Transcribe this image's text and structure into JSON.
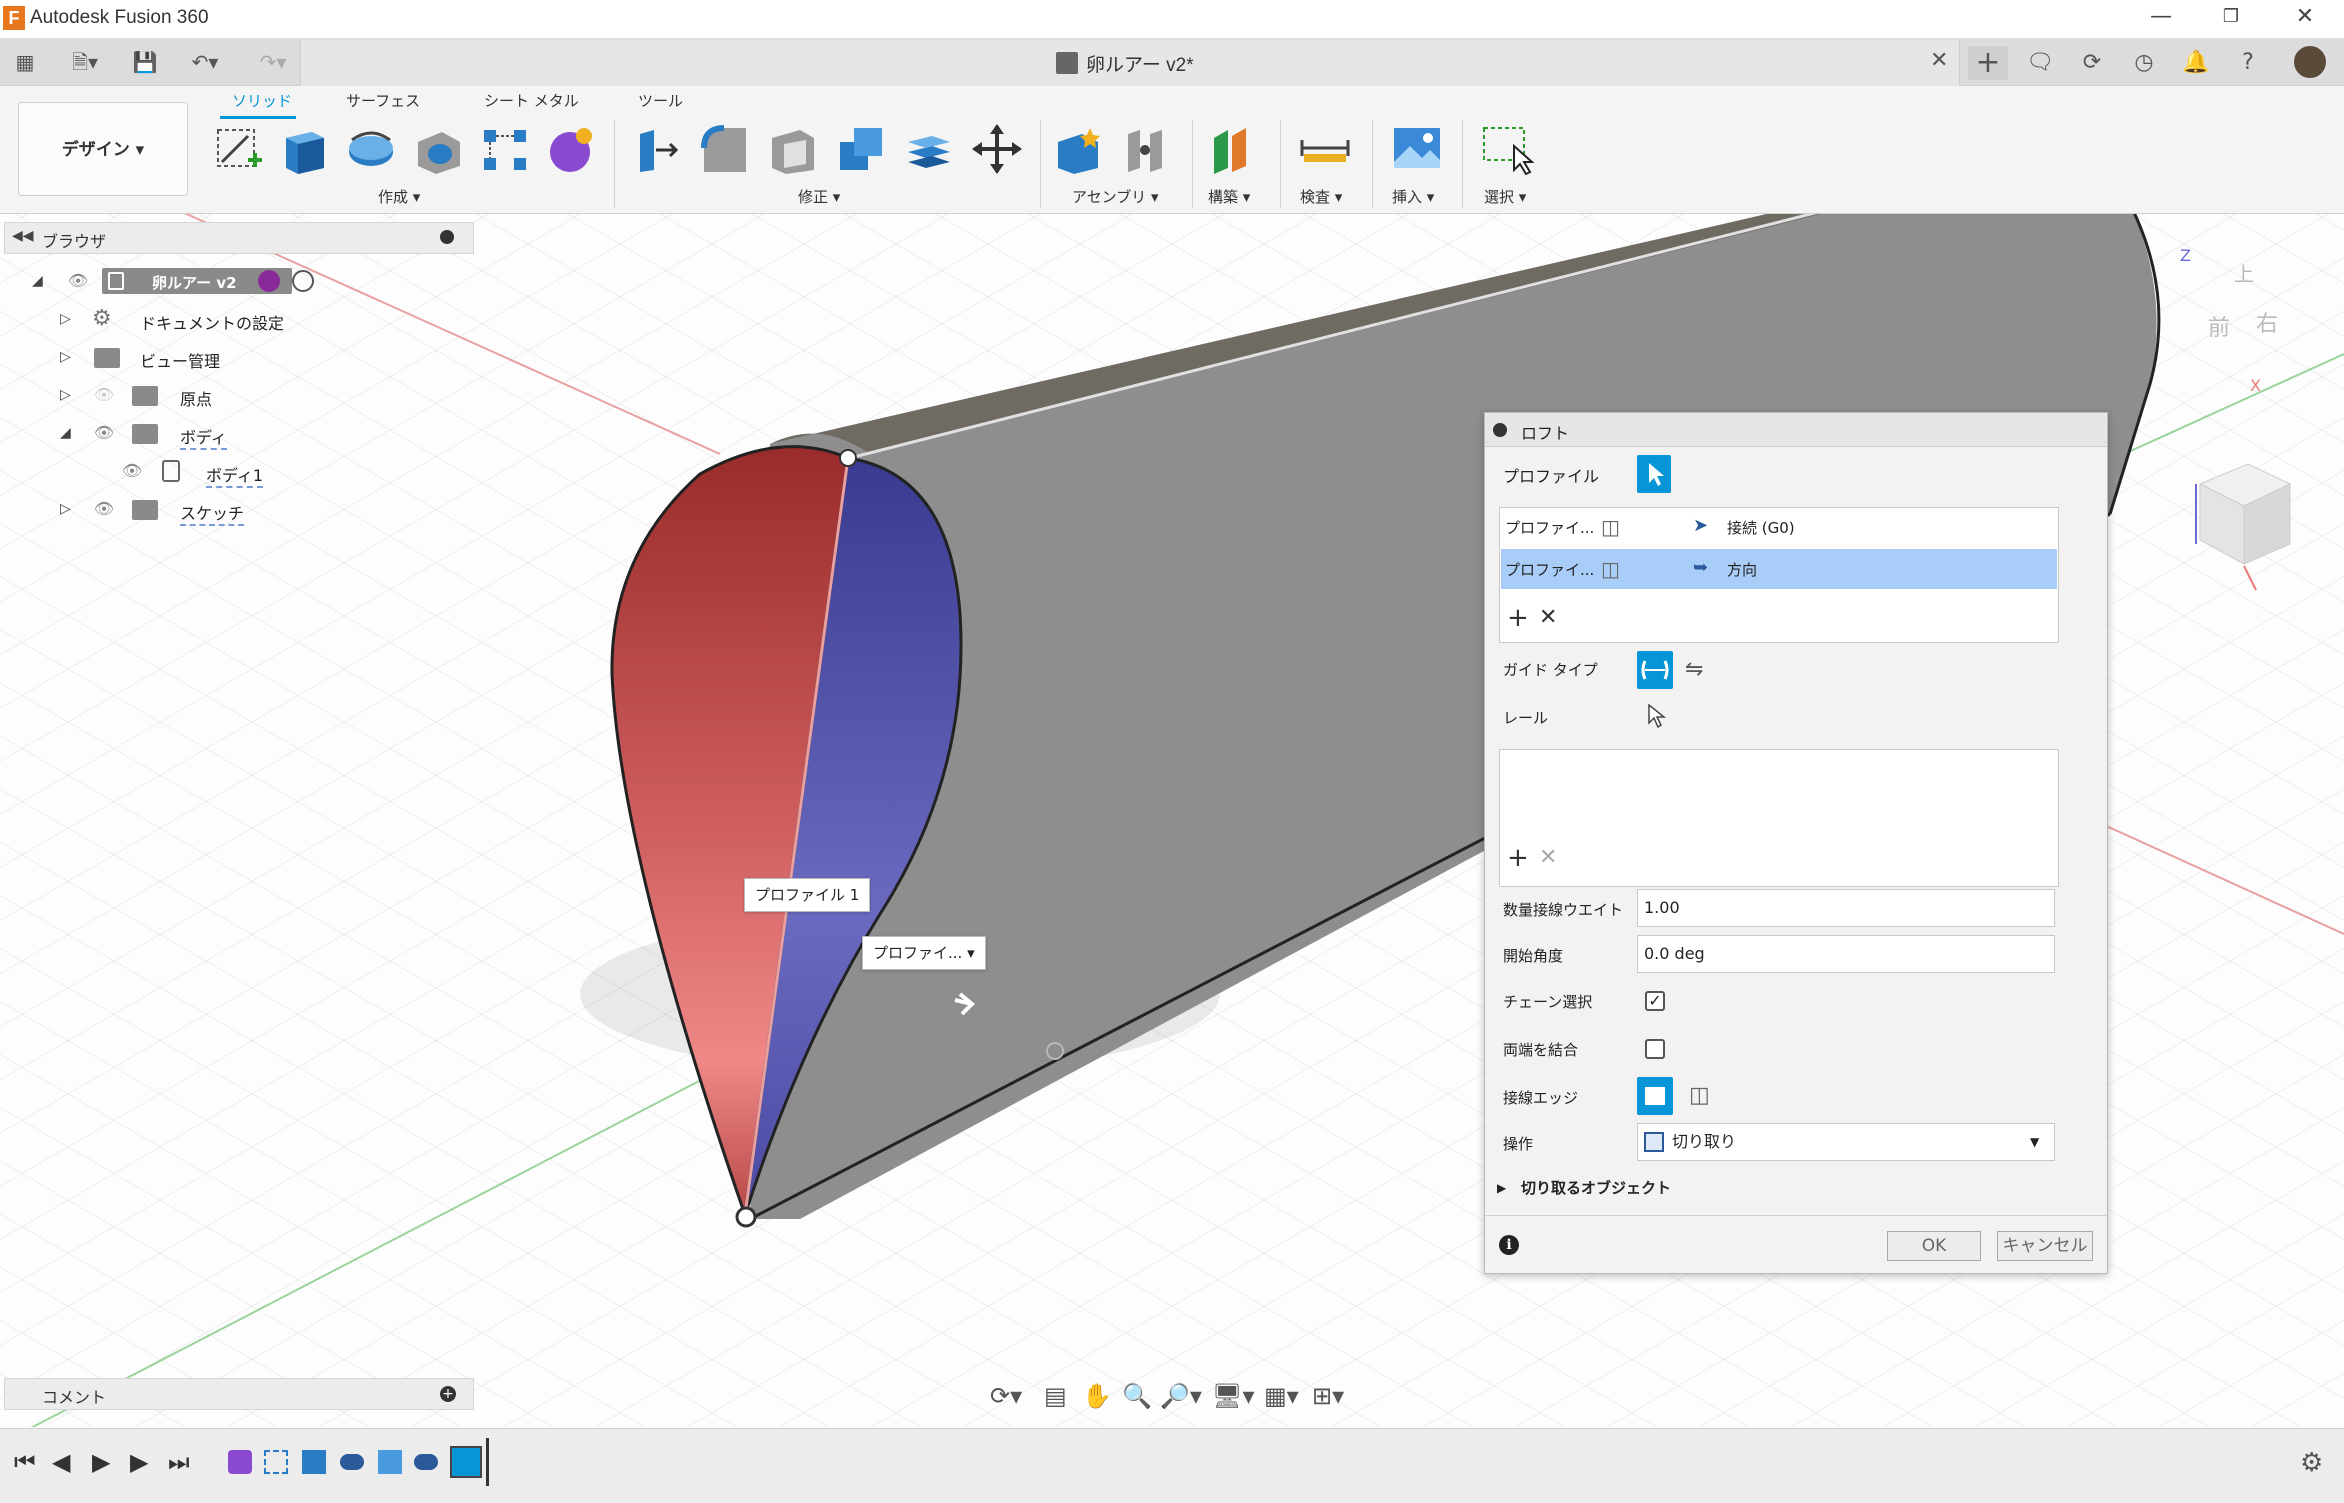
{
  "window": {
    "title": "Autodesk Fusion 360",
    "logo": "F"
  },
  "document": {
    "tab_title": "卵ルアー v2*"
  },
  "workspace": {
    "label": "デザイン ▾"
  },
  "ribbon": {
    "tabs": [
      "ソリッド",
      "サーフェス",
      "シート メタル",
      "ツール"
    ],
    "active_tab": "ソリッド",
    "groups": {
      "create": "作成 ▾",
      "modify": "修正 ▾",
      "assemble": "アセンブリ ▾",
      "construct": "構築 ▾",
      "inspect": "検査 ▾",
      "insert": "挿入 ▾",
      "select": "選択 ▾"
    }
  },
  "browser": {
    "title": "ブラウザ",
    "root": "卵ルアー v2",
    "items": [
      {
        "label": "ドキュメントの設定"
      },
      {
        "label": "ビュー管理"
      },
      {
        "label": "原点"
      },
      {
        "label": "ボディ"
      },
      {
        "label": "ボディ1"
      },
      {
        "label": "スケッチ"
      }
    ]
  },
  "comments": {
    "label": "コメント"
  },
  "viewport": {
    "callout_1": "プロファイル 1",
    "callout_2": "プロファイ... ▾",
    "viewcube": {
      "top": "上",
      "front": "前",
      "right": "右",
      "z": "Z",
      "x": "X"
    }
  },
  "loft_dialog": {
    "title": "ロフト",
    "profile_label": "プロファイル",
    "profiles": [
      {
        "name": "プロファイ...",
        "condition": "接続 (G0)"
      },
      {
        "name": "プロファイ...",
        "condition": "方向"
      }
    ],
    "guide_type_label": "ガイド タイプ",
    "rail_label": "レール",
    "tangent_weight_label": "数量接線ウエイト",
    "tangent_weight_value": "1.00",
    "start_angle_label": "開始角度",
    "start_angle_value": "0.0 deg",
    "chain_select_label": "チェーン選択",
    "chain_select_checked": "✓",
    "merge_ends_label": "両端を結合",
    "merge_ends_checked": "",
    "tangent_edges_label": "接線エッジ",
    "operation_label": "操作",
    "operation_value": "切り取り",
    "cut_objects_label": "切り取るオブジェクト",
    "ok_label": "OK",
    "cancel_label": "キャンセル"
  },
  "colors": {
    "accent": "#0696d7",
    "profile_red": "#c0504d",
    "profile_blue": "#5a5ab4",
    "body_gray": "#8e8e8e"
  }
}
